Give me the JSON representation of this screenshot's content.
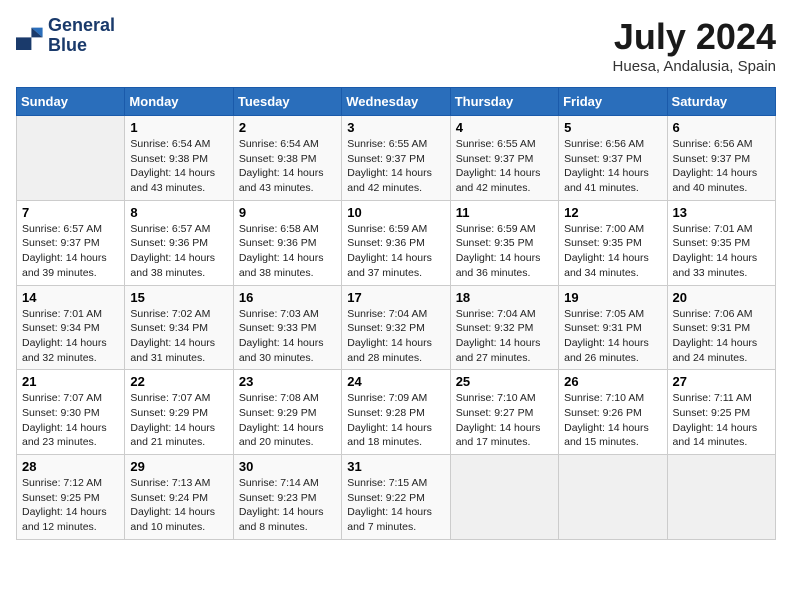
{
  "header": {
    "logo_line1": "General",
    "logo_line2": "Blue",
    "month_year": "July 2024",
    "location": "Huesa, Andalusia, Spain"
  },
  "days_of_week": [
    "Sunday",
    "Monday",
    "Tuesday",
    "Wednesday",
    "Thursday",
    "Friday",
    "Saturday"
  ],
  "weeks": [
    [
      {
        "num": "",
        "info": ""
      },
      {
        "num": "1",
        "info": "Sunrise: 6:54 AM\nSunset: 9:38 PM\nDaylight: 14 hours\nand 43 minutes."
      },
      {
        "num": "2",
        "info": "Sunrise: 6:54 AM\nSunset: 9:38 PM\nDaylight: 14 hours\nand 43 minutes."
      },
      {
        "num": "3",
        "info": "Sunrise: 6:55 AM\nSunset: 9:37 PM\nDaylight: 14 hours\nand 42 minutes."
      },
      {
        "num": "4",
        "info": "Sunrise: 6:55 AM\nSunset: 9:37 PM\nDaylight: 14 hours\nand 42 minutes."
      },
      {
        "num": "5",
        "info": "Sunrise: 6:56 AM\nSunset: 9:37 PM\nDaylight: 14 hours\nand 41 minutes."
      },
      {
        "num": "6",
        "info": "Sunrise: 6:56 AM\nSunset: 9:37 PM\nDaylight: 14 hours\nand 40 minutes."
      }
    ],
    [
      {
        "num": "7",
        "info": "Sunrise: 6:57 AM\nSunset: 9:37 PM\nDaylight: 14 hours\nand 39 minutes."
      },
      {
        "num": "8",
        "info": "Sunrise: 6:57 AM\nSunset: 9:36 PM\nDaylight: 14 hours\nand 38 minutes."
      },
      {
        "num": "9",
        "info": "Sunrise: 6:58 AM\nSunset: 9:36 PM\nDaylight: 14 hours\nand 38 minutes."
      },
      {
        "num": "10",
        "info": "Sunrise: 6:59 AM\nSunset: 9:36 PM\nDaylight: 14 hours\nand 37 minutes."
      },
      {
        "num": "11",
        "info": "Sunrise: 6:59 AM\nSunset: 9:35 PM\nDaylight: 14 hours\nand 36 minutes."
      },
      {
        "num": "12",
        "info": "Sunrise: 7:00 AM\nSunset: 9:35 PM\nDaylight: 14 hours\nand 34 minutes."
      },
      {
        "num": "13",
        "info": "Sunrise: 7:01 AM\nSunset: 9:35 PM\nDaylight: 14 hours\nand 33 minutes."
      }
    ],
    [
      {
        "num": "14",
        "info": "Sunrise: 7:01 AM\nSunset: 9:34 PM\nDaylight: 14 hours\nand 32 minutes."
      },
      {
        "num": "15",
        "info": "Sunrise: 7:02 AM\nSunset: 9:34 PM\nDaylight: 14 hours\nand 31 minutes."
      },
      {
        "num": "16",
        "info": "Sunrise: 7:03 AM\nSunset: 9:33 PM\nDaylight: 14 hours\nand 30 minutes."
      },
      {
        "num": "17",
        "info": "Sunrise: 7:04 AM\nSunset: 9:32 PM\nDaylight: 14 hours\nand 28 minutes."
      },
      {
        "num": "18",
        "info": "Sunrise: 7:04 AM\nSunset: 9:32 PM\nDaylight: 14 hours\nand 27 minutes."
      },
      {
        "num": "19",
        "info": "Sunrise: 7:05 AM\nSunset: 9:31 PM\nDaylight: 14 hours\nand 26 minutes."
      },
      {
        "num": "20",
        "info": "Sunrise: 7:06 AM\nSunset: 9:31 PM\nDaylight: 14 hours\nand 24 minutes."
      }
    ],
    [
      {
        "num": "21",
        "info": "Sunrise: 7:07 AM\nSunset: 9:30 PM\nDaylight: 14 hours\nand 23 minutes."
      },
      {
        "num": "22",
        "info": "Sunrise: 7:07 AM\nSunset: 9:29 PM\nDaylight: 14 hours\nand 21 minutes."
      },
      {
        "num": "23",
        "info": "Sunrise: 7:08 AM\nSunset: 9:29 PM\nDaylight: 14 hours\nand 20 minutes."
      },
      {
        "num": "24",
        "info": "Sunrise: 7:09 AM\nSunset: 9:28 PM\nDaylight: 14 hours\nand 18 minutes."
      },
      {
        "num": "25",
        "info": "Sunrise: 7:10 AM\nSunset: 9:27 PM\nDaylight: 14 hours\nand 17 minutes."
      },
      {
        "num": "26",
        "info": "Sunrise: 7:10 AM\nSunset: 9:26 PM\nDaylight: 14 hours\nand 15 minutes."
      },
      {
        "num": "27",
        "info": "Sunrise: 7:11 AM\nSunset: 9:25 PM\nDaylight: 14 hours\nand 14 minutes."
      }
    ],
    [
      {
        "num": "28",
        "info": "Sunrise: 7:12 AM\nSunset: 9:25 PM\nDaylight: 14 hours\nand 12 minutes."
      },
      {
        "num": "29",
        "info": "Sunrise: 7:13 AM\nSunset: 9:24 PM\nDaylight: 14 hours\nand 10 minutes."
      },
      {
        "num": "30",
        "info": "Sunrise: 7:14 AM\nSunset: 9:23 PM\nDaylight: 14 hours\nand 8 minutes."
      },
      {
        "num": "31",
        "info": "Sunrise: 7:15 AM\nSunset: 9:22 PM\nDaylight: 14 hours\nand 7 minutes."
      },
      {
        "num": "",
        "info": ""
      },
      {
        "num": "",
        "info": ""
      },
      {
        "num": "",
        "info": ""
      }
    ]
  ]
}
